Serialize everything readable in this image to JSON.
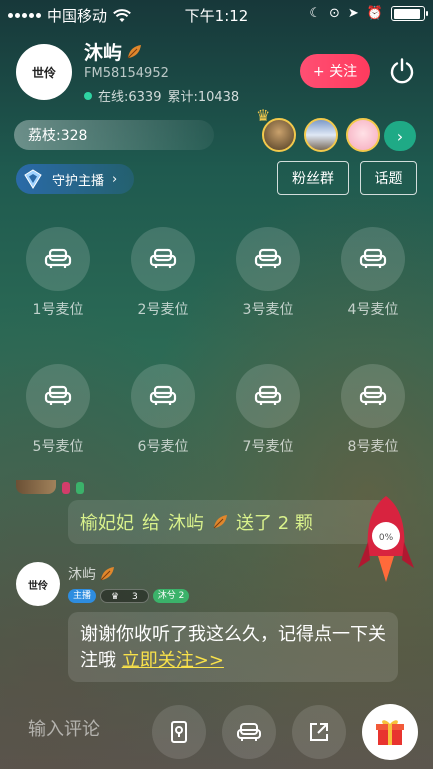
{
  "status_bar": {
    "carrier": "中国移动",
    "time": "下午1:12",
    "battery_level": 0.9
  },
  "host": {
    "avatar_text": "世伶",
    "name": "沐屿",
    "id": "FM58154952",
    "online_label": "在线:6339",
    "total_label": "累计:10438",
    "follow_label": "+ 关注"
  },
  "lychee": {
    "label": "荔枝:328"
  },
  "top_fans": {
    "more_label": "›"
  },
  "actions": {
    "guard_label": "守护主播",
    "guard_arrow": "›",
    "fans_group_label": "粉丝群",
    "topic_label": "话题"
  },
  "seats": [
    {
      "label": "1号麦位"
    },
    {
      "label": "2号麦位"
    },
    {
      "label": "3号麦位"
    },
    {
      "label": "4号麦位"
    },
    {
      "label": "5号麦位"
    },
    {
      "label": "6号麦位"
    },
    {
      "label": "7号麦位"
    },
    {
      "label": "8号麦位"
    }
  ],
  "chat": {
    "gift_message": {
      "sender": "榆妃妃",
      "verb": "给",
      "receiver": "沐屿",
      "action": "送了 2 颗"
    },
    "rocket_progress": "0%",
    "host_message": {
      "avatar_text": "世伶",
      "name": "沐屿",
      "badge_host": "主播",
      "badge_level": "3",
      "badge_fan": "沐兮 2",
      "text": "谢谢你收听了我这么久，记得点一下关注哦",
      "link": "立即关注>>"
    }
  },
  "bottom": {
    "comment_placeholder": "输入评论"
  },
  "colors": {
    "follow": "#ff4f73",
    "online_dot": "#2fd3a2",
    "link": "#f9e24a",
    "gift_text": "#d9f28c",
    "more_fans": "#1faa86"
  }
}
